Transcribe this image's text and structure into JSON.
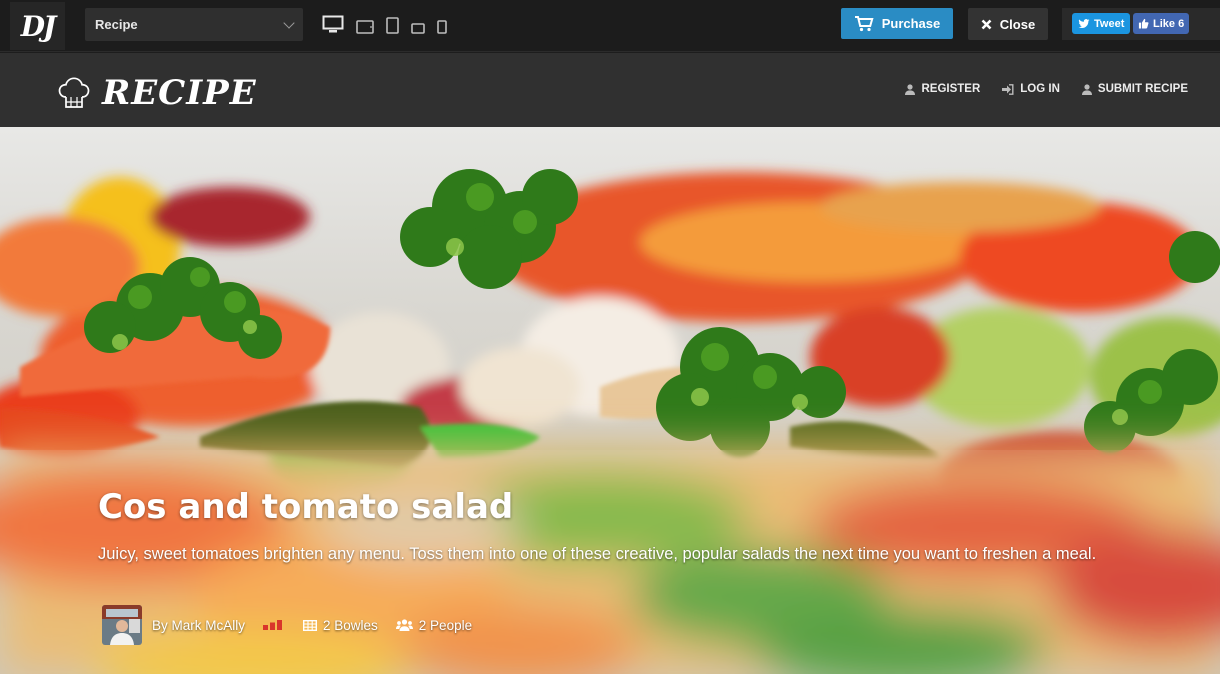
{
  "topbar": {
    "logo_text": "DJ",
    "theme_selector": {
      "selected": "Recipe"
    },
    "devices": [
      "desktop-icon",
      "tablet-landscape-icon",
      "tablet-portrait-icon",
      "phone-landscape-icon",
      "phone-portrait-icon"
    ],
    "purchase_label": "Purchase",
    "close_label": "Close",
    "tweet_label": "Tweet",
    "like_label": "Like 6"
  },
  "header": {
    "brand": "RECIPE",
    "nav": [
      {
        "label": "REGISTER",
        "icon": "user-icon"
      },
      {
        "label": "LOG IN",
        "icon": "sign-in-icon"
      },
      {
        "label": "SUBMIT RECIPE",
        "icon": "user-icon"
      }
    ]
  },
  "hero": {
    "title": "Cos and tomato salad",
    "subtitle": "Juicy, sweet tomatoes brighten any menu. Toss them into one of these creative, popular salads the next time you want to freshen a meal.",
    "author": "By Mark McAlly",
    "difficulty_bars": 3,
    "servings": "2 Bowles",
    "people": "2 People"
  },
  "colors": {
    "purchase": "#2a8cc4",
    "tweet": "#1b95e0",
    "like": "#4267b2",
    "difficulty": "#d9352b"
  }
}
